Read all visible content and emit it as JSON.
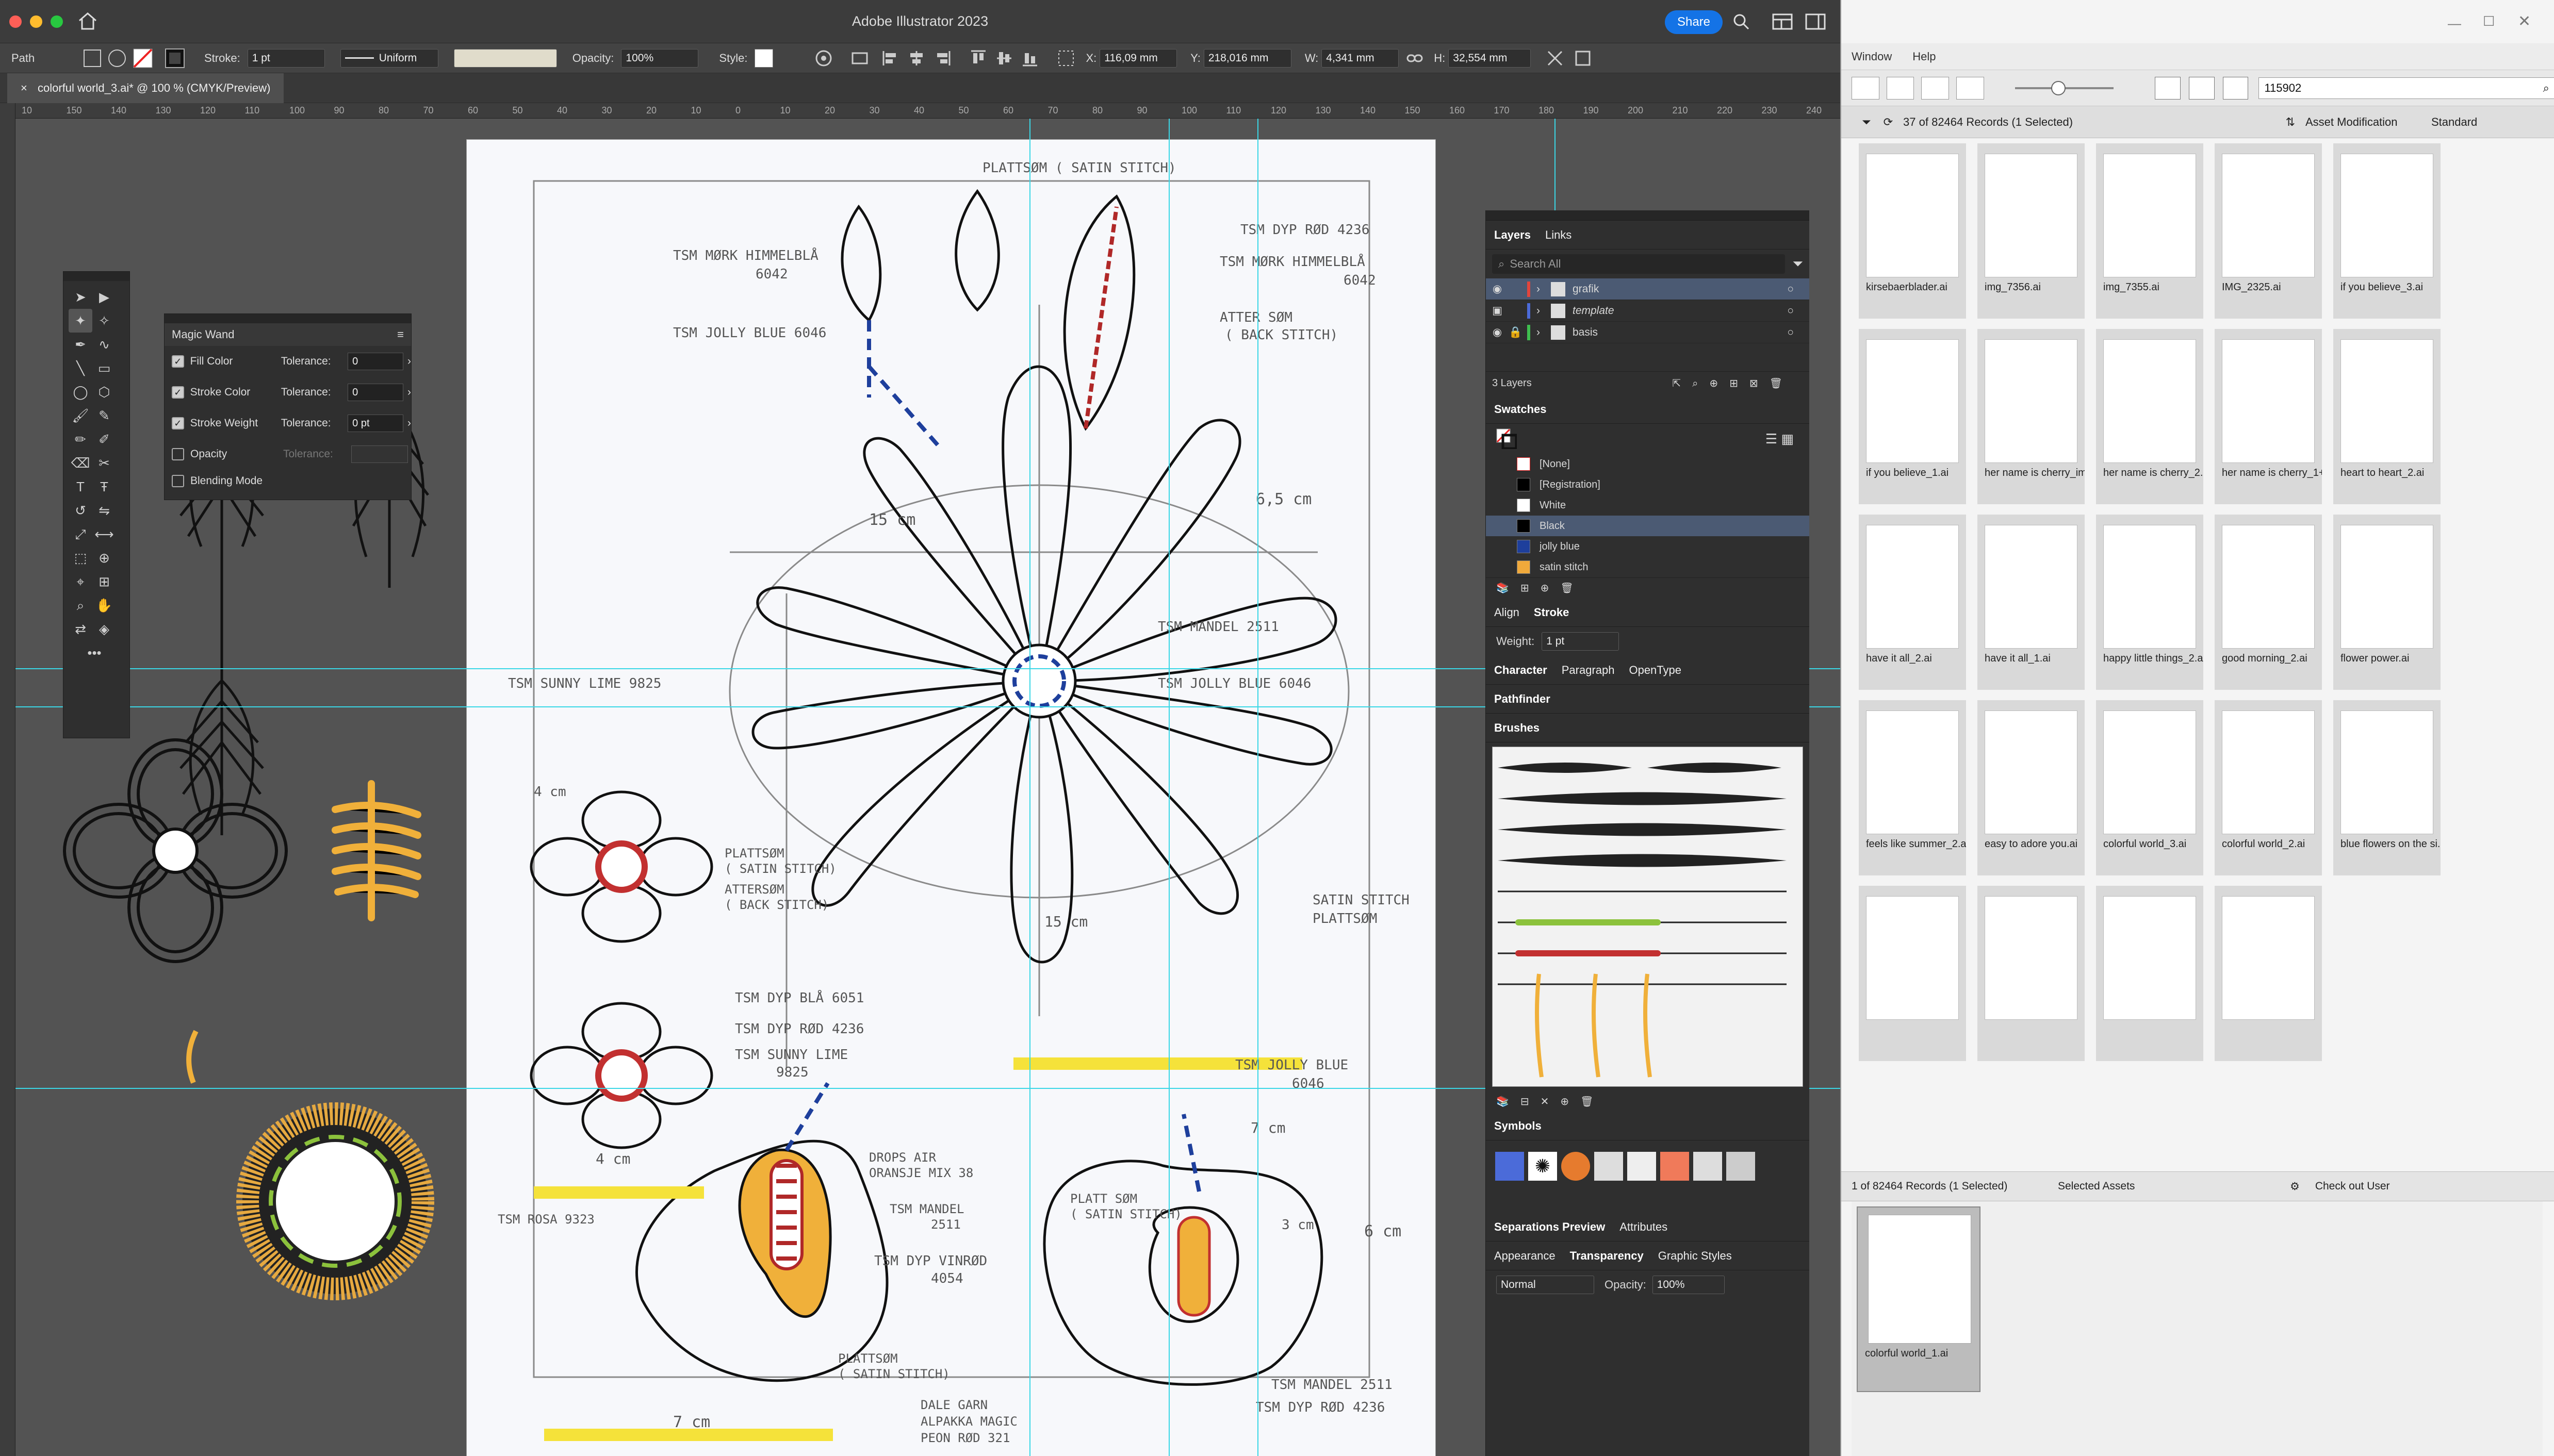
{
  "app": {
    "title": "Adobe Illustrator 2023",
    "share_label": "Share",
    "doc_tab": "colorful world_3.ai* @ 100 % (CMYK/Preview)"
  },
  "control_bar": {
    "path_label": "Path",
    "stroke_label": "Stroke:",
    "stroke_value": "1 pt",
    "profile_value": "Uniform",
    "opacity_label": "Opacity:",
    "opacity_value": "100%",
    "style_label": "Style:",
    "x_label": "X:",
    "x_value": "116,09 mm",
    "y_label": "Y:",
    "y_value": "218,016 mm",
    "w_label": "W:",
    "w_value": "4,341 mm",
    "h_label": "H:",
    "h_value": "32,554 mm"
  },
  "ruler": {
    "ticks": [
      "10",
      "150",
      "140",
      "130",
      "120",
      "110",
      "100",
      "90",
      "80",
      "70",
      "60",
      "50",
      "40",
      "30",
      "20",
      "10",
      "0",
      "10",
      "20",
      "30",
      "40",
      "50",
      "60",
      "70",
      "80",
      "90",
      "100",
      "110",
      "120",
      "130",
      "140",
      "150",
      "160",
      "170",
      "180",
      "190",
      "200",
      "210",
      "220",
      "230",
      "240",
      "25"
    ]
  },
  "magic_wand": {
    "title": "Magic Wand",
    "rows": [
      {
        "label": "Fill Color",
        "checked": true,
        "tolerance_label": "Tolerance:",
        "tolerance": "0"
      },
      {
        "label": "Stroke Color",
        "checked": true,
        "tolerance_label": "Tolerance:",
        "tolerance": "0"
      },
      {
        "label": "Stroke Weight",
        "checked": true,
        "tolerance_label": "Tolerance:",
        "tolerance": "0 pt"
      },
      {
        "label": "Opacity",
        "checked": false,
        "tolerance_label": "Tolerance:",
        "tolerance": ""
      },
      {
        "label": "Blending Mode",
        "checked": false,
        "tolerance_label": "",
        "tolerance": ""
      }
    ]
  },
  "layers_panel": {
    "tabs": [
      "Layers",
      "Links"
    ],
    "search_placeholder": "Search All",
    "layers": [
      {
        "name": "grafik",
        "color": "#e2453c",
        "selected": true
      },
      {
        "name": "template",
        "color": "#4b6bd9",
        "selected": false
      },
      {
        "name": "basis",
        "color": "#3fbf4f",
        "selected": false
      }
    ],
    "count": "3 Layers"
  },
  "swatches_panel": {
    "title": "Swatches",
    "swatches": [
      {
        "name": "[None]",
        "color": "#ffffff"
      },
      {
        "name": "[Registration]",
        "color": "#000000"
      },
      {
        "name": "White",
        "color": "#ffffff"
      },
      {
        "name": "Black",
        "color": "#000000"
      },
      {
        "name": "jolly blue",
        "color": "#1e3f9c"
      },
      {
        "name": "satin stitch",
        "color": "#f0a93b"
      }
    ]
  },
  "align_stroke": {
    "tabs": [
      "Align",
      "Stroke"
    ],
    "weight_label": "Weight:",
    "weight_value": "1 pt"
  },
  "char_tabs": [
    "Character",
    "Paragraph",
    "OpenType"
  ],
  "pathfinder_title": "Pathfinder",
  "brushes_title": "Brushes",
  "symbols_title": "Symbols",
  "sep_tabs": [
    "Separations Preview",
    "Attributes"
  ],
  "appearance_tabs": [
    "Appearance",
    "Transparency",
    "Graphic Styles"
  ],
  "transparency": {
    "mode": "Normal",
    "opacity_label": "Opacity:",
    "opacity_value": "100%"
  },
  "bridge": {
    "menu": [
      "Window",
      "Help"
    ],
    "search_value": "115902",
    "records_label": "37 of 82464 Records (1 Selected)",
    "filter_label": "Asset Modification",
    "view_label": "Standard",
    "thumbnails": [
      {
        "name": "kirsebaerblader.ai"
      },
      {
        "name": "img_7356.ai"
      },
      {
        "name": "img_7355.ai"
      },
      {
        "name": "IMG_2325.ai"
      },
      {
        "name": "if you believe_3.ai"
      },
      {
        "name": "if you believe_1.ai"
      },
      {
        "name": "her name is cherry_img.ai"
      },
      {
        "name": "her name is cherry_2.ai"
      },
      {
        "name": "her name is cherry_1+3.ai"
      },
      {
        "name": "heart to heart_2.ai"
      },
      {
        "name": "have it all_2.ai"
      },
      {
        "name": "have it all_1.ai"
      },
      {
        "name": "happy little things_2.ai"
      },
      {
        "name": "good morning_2.ai"
      },
      {
        "name": "flower power.ai"
      },
      {
        "name": "feels like summer_2.ai"
      },
      {
        "name": "easy to adore you.ai"
      },
      {
        "name": "colorful world_3.ai"
      },
      {
        "name": "colorful world_2.ai"
      },
      {
        "name": "blue flowers on the si..."
      },
      {
        "name": ""
      },
      {
        "name": ""
      },
      {
        "name": ""
      },
      {
        "name": ""
      }
    ],
    "status_records": "1 of 82464 Records (1 Selected)",
    "status_selected": "Selected Assets",
    "status_checkout": "Check out User",
    "collection_item": "colorful world_1.ai"
  },
  "artboard_text": {
    "t1": "PLATTSØM ( SATIN STITCH)",
    "t2": "TSM  MØRK HIMMELBLÅ",
    "t3": "6042",
    "t4": "TSM  JOLLY BLUE  6046",
    "t5": "TSM  DYP RØD  4236",
    "t6": "TSM  MØRK HIMMELBLÅ",
    "t7": "6042",
    "t8": "ATTER SØM",
    "t9": "( BACK STITCH)",
    "t10": "15 cm",
    "t11": "6,5 cm",
    "t12": "TSM  MANDEL  2511",
    "t13": "TSM  SUNNY LIME  9825",
    "t14": "TSM  JOLLY BLUE  6046",
    "t15": "4 cm",
    "t16": "PLATTSØM",
    "t17": "( SATIN STITCH)",
    "t18": "ATTERSØM",
    "t19": "( BACK STITCH)",
    "t20": "SATIN STITCH",
    "t21": "PLATTSØM",
    "t22": "15 cm",
    "t23": "TSM  DYP BLÅ  6051",
    "t24": "TSM  DYP RØD  4236",
    "t25": "TSM  SUNNY LIME",
    "t26": "9825",
    "t27": "TSM  JOLLY BLUE",
    "t28": "6046",
    "t29": "4 cm",
    "t30": "DROPS AIR",
    "t31": "ORANSJE MIX 38",
    "t32": "TSM  MANDEL",
    "t33": "2511",
    "t34": "TSM  ROSA  9323",
    "t35": "TSM  DYP VINRØD",
    "t36": "4054",
    "t37": "PLATT SØM",
    "t38": "( SATIN STITCH)",
    "t39": "7 cm",
    "t40": "3 cm",
    "t41": "6 cm",
    "t42": "PLATTSØM",
    "t43": "( SATIN STITCH)",
    "t44": "TSM  MANDEL  2511",
    "t45": "TSM  DYP RØD  4236",
    "t46": "DALE GARN",
    "t47": "ALPAKKA MAGIC",
    "t48": "PEON RØD  321",
    "t49": "7 cm"
  }
}
